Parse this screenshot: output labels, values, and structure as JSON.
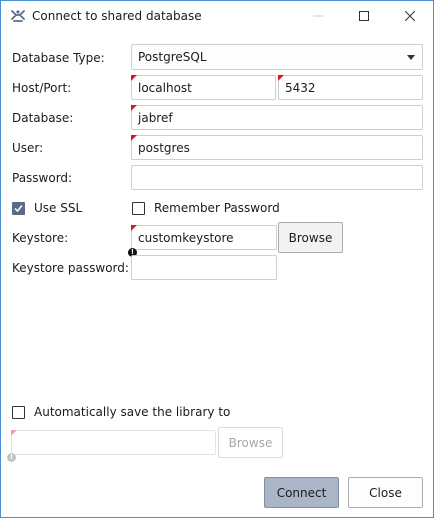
{
  "window": {
    "title": "Connect to shared database",
    "app_icon": "jabref-icon",
    "controls": [
      "minimize-icon",
      "maximize-icon",
      "close-icon"
    ]
  },
  "form": {
    "database_type": {
      "label": "Database Type:",
      "value": "PostgreSQL"
    },
    "host_port": {
      "label": "Host/Port:",
      "host": "localhost",
      "port": "5432"
    },
    "database": {
      "label": "Database:",
      "value": "jabref"
    },
    "user": {
      "label": "User:",
      "value": "postgres"
    },
    "password": {
      "label": "Password:",
      "value": ""
    },
    "use_ssl": {
      "label": "Use SSL",
      "checked": true
    },
    "remember_password": {
      "label": "Remember Password",
      "checked": false
    },
    "keystore": {
      "label": "Keystore:",
      "value": "customkeystore",
      "browse_label": "Browse"
    },
    "keystore_password": {
      "label": "Keystore password:",
      "value": ""
    },
    "autosave": {
      "label": "Automatically save the library to",
      "checked": false,
      "path": "",
      "browse_label": "Browse"
    }
  },
  "warning_glyph": "!",
  "actions": {
    "connect_label": "Connect",
    "close_label": "Close"
  },
  "colors": {
    "accent": "#5a6b89",
    "invalid_marker": "#e81123",
    "window_border": "#4a8fd6"
  }
}
